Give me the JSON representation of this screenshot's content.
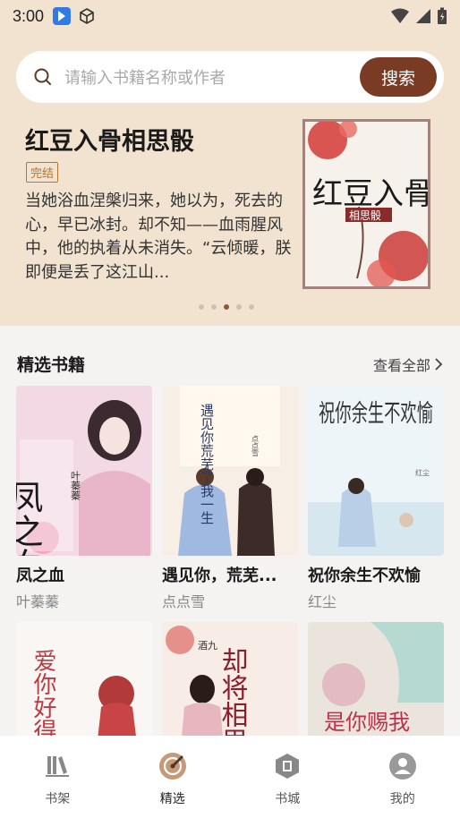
{
  "status_bar": {
    "time": "3:00"
  },
  "search": {
    "placeholder": "请输入书籍名称或作者",
    "button_label": "搜索"
  },
  "hero": {
    "title": "红豆入骨相思骰",
    "badge": "完结",
    "description": "当她浴血涅槃归来，她以为，死去的心，早已冰封。却不知——血雨腥风中，他的执着从未消失。“云倾暖，朕即便是丢了这江山...",
    "cover_text": "红豆入骨",
    "cover_subtitle": "相思骰",
    "carousel": {
      "count": 5,
      "active_index": 2
    }
  },
  "section": {
    "title": "精选书籍",
    "view_all_label": "查看全部"
  },
  "books": [
    {
      "title": "凤之血",
      "author": "叶蓁蓁",
      "cover_text": "凤之血",
      "cover_author": "叶蓁蓁"
    },
    {
      "title": "遇见你，荒芜了我一生",
      "display_title": "遇见你，荒芜...",
      "author": "点点雪",
      "cover_text": "遇见你荒芜了我一生",
      "cover_author": "点点雪"
    },
    {
      "title": "祝你余生不欢愉",
      "author": "红尘",
      "cover_text": "祝你余生不欢愉",
      "cover_author": "红尘"
    },
    {
      "cover_text": "爱你好得心累"
    },
    {
      "cover_text": "却将相思",
      "cover_author": "酒九"
    },
    {
      "cover_text": "是你赐我"
    }
  ],
  "bottom_nav": [
    {
      "label": "书架",
      "icon": "bookshelf-icon",
      "active": false
    },
    {
      "label": "精选",
      "icon": "featured-icon",
      "active": true
    },
    {
      "label": "书城",
      "icon": "bookstore-icon",
      "active": false
    },
    {
      "label": "我的",
      "icon": "profile-icon",
      "active": false
    }
  ],
  "colors": {
    "header_bg": "#f1e3d0",
    "accent": "#7a3b25",
    "badge": "#b8742e"
  }
}
